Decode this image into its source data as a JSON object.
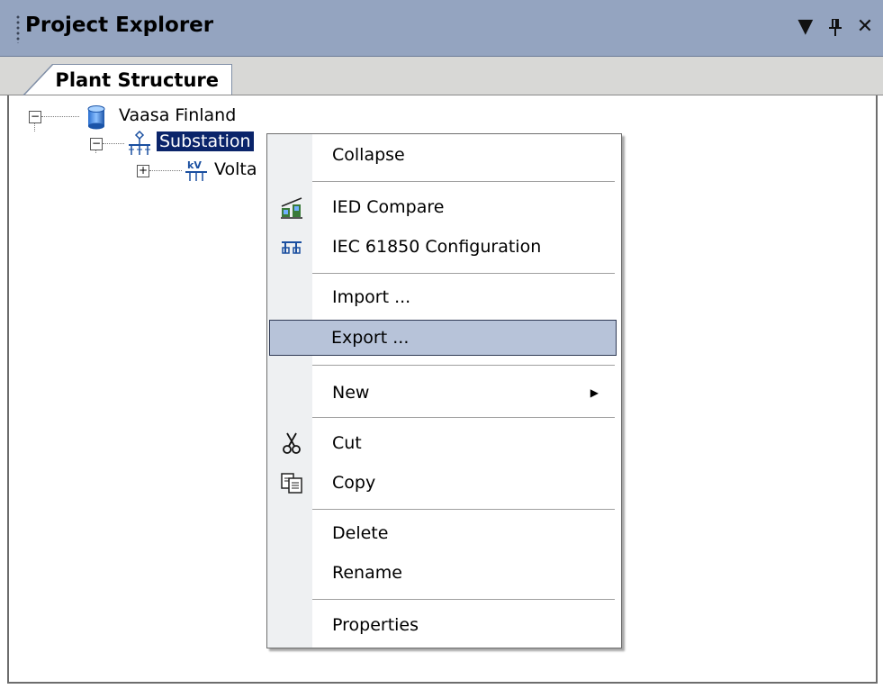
{
  "window": {
    "title": "Project Explorer",
    "controls": [
      "▼",
      "ᛘ",
      "✕"
    ]
  },
  "tabs": [
    {
      "label": "Plant Structure",
      "active": true
    }
  ],
  "tree": {
    "root": {
      "label": "Vaasa Finland",
      "icon": "database-icon",
      "expanded": true
    },
    "child": {
      "label": "Substation",
      "icon": "substation-icon",
      "expanded": true,
      "selected": true
    },
    "grandchild": {
      "label": "Volta",
      "icon": "voltage-level-icon",
      "expanded": false
    }
  },
  "context_menu": {
    "items": [
      {
        "label": "Collapse"
      },
      {
        "label": "IED Compare",
        "icon": "ied-compare-icon"
      },
      {
        "label": "IEC 61850 Configuration",
        "icon": "iec-config-icon"
      },
      {
        "label": "Import ..."
      },
      {
        "label": "Export ...",
        "highlighted": true
      },
      {
        "label": "New",
        "submenu": true
      },
      {
        "label": "Cut",
        "icon": "scissors-icon"
      },
      {
        "label": "Copy",
        "icon": "copy-icon"
      },
      {
        "label": "Delete"
      },
      {
        "label": "Rename"
      },
      {
        "label": "Properties"
      }
    ]
  },
  "colors": {
    "titlebar": "#94a4c0",
    "selection": "#0a246a",
    "menu_highlight": "#b7c3d9",
    "menu_gutter": "#eef0f2"
  }
}
